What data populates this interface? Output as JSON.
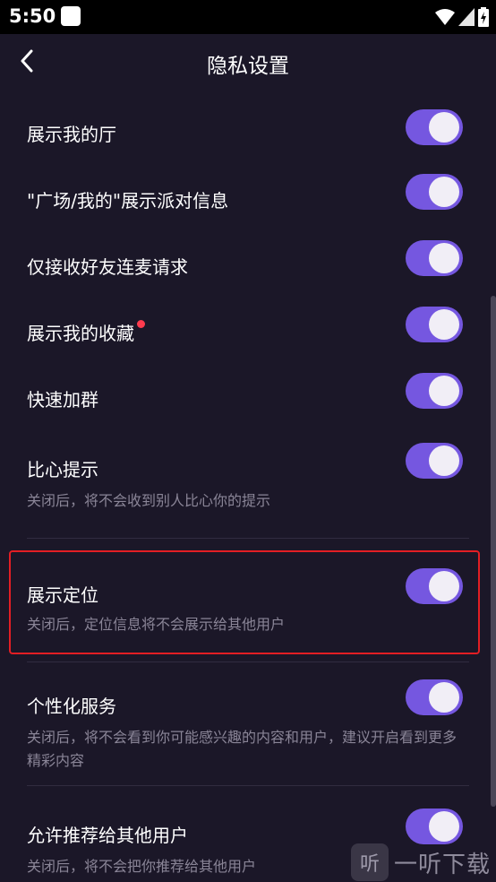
{
  "status": {
    "time": "5:50"
  },
  "header": {
    "title": "隐私设置"
  },
  "settings": [
    {
      "label": "展示我的厅",
      "enabled": true
    },
    {
      "label": "\"广场/我的\"展示派对信息",
      "enabled": true
    },
    {
      "label": "仅接收好友连麦请求",
      "enabled": true
    },
    {
      "label": "展示我的收藏",
      "enabled": true
    },
    {
      "label": "快速加群",
      "enabled": true
    },
    {
      "label": "比心提示",
      "desc": "关闭后，将不会收到别人比心你的提示",
      "enabled": true
    },
    {
      "label": "展示定位",
      "desc": "关闭后，定位信息将不会展示给其他用户",
      "enabled": true
    },
    {
      "label": "个性化服务",
      "desc": "关闭后，将不会看到你可能感兴趣的内容和用户，建议开启看到更多精彩内容",
      "enabled": true
    },
    {
      "label": "允许推荐给其他用户",
      "desc": "关闭后，将不会把你推荐给其他用户",
      "enabled": true
    }
  ],
  "watermark": {
    "icon_text": "听",
    "text": "一听下载"
  },
  "colors": {
    "background": "#1b1728",
    "toggle_on": "#7557e0",
    "highlight": "#e31e24",
    "dot": "#ff3b4e"
  }
}
